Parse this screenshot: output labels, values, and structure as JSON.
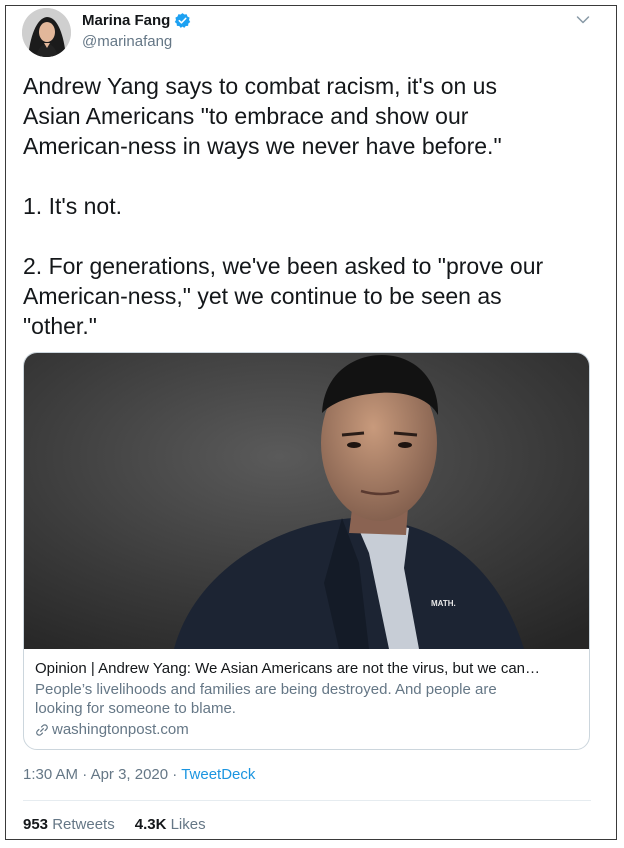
{
  "user": {
    "display_name": "Marina Fang",
    "handle": "@marinafang",
    "avatar_icon": "profile-photo",
    "verified_icon": "verified-badge-icon"
  },
  "menu_icon": "chevron-down-icon",
  "tweet": {
    "line1": "Andrew Yang says to combat racism, it's on us",
    "line2": "Asian Americans \"to embrace and show our",
    "line3": "American-ness in ways we never have before.\"",
    "point1": "1. It's not.",
    "point2_line1": "2. For generations, we've been asked to \"prove our",
    "point2_line2": "American-ness,\" yet we continue to be seen as",
    "point2_line3": "\"other.\""
  },
  "card": {
    "image_label": "MATH.",
    "title": "Opinion | Andrew Yang: We Asian Americans are not the virus, but we can…",
    "description_line1": "People’s livelihoods and families are being destroyed. And people are",
    "description_line2": "looking for someone to blame.",
    "domain": "washingtonpost.com",
    "link_icon": "link-icon"
  },
  "meta": {
    "time": "1:30 AM",
    "separator1": " · ",
    "date": "Apr 3, 2020",
    "separator2": " · ",
    "source": "TweetDeck"
  },
  "stats": {
    "retweets_count": "953",
    "retweets_label": " Retweets",
    "likes_count": "4.3K",
    "likes_label": " Likes"
  },
  "colors": {
    "text": "#14171a",
    "secondary": "#657786",
    "link": "#1b95e0",
    "border": "#ccd6dd"
  }
}
